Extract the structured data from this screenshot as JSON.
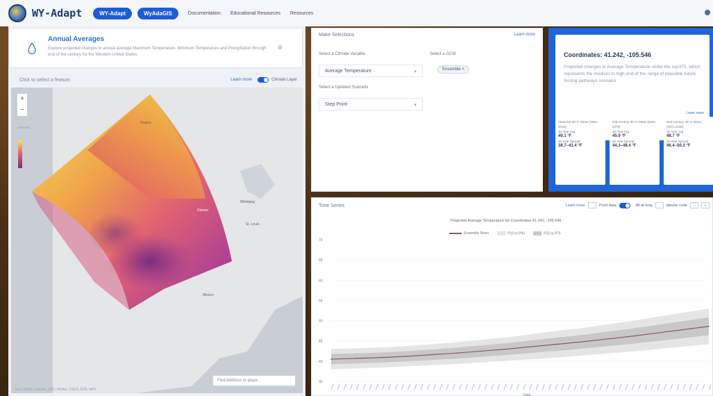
{
  "header": {
    "brand": "WY-Adapt",
    "pills": [
      "WY-Adapt",
      "WyAdaGIS"
    ],
    "nav": [
      "Documentation",
      "Educational Resources",
      "Resources"
    ]
  },
  "annual": {
    "title": "Annual Averages",
    "description": "Explore projected changes in annual average Maximum Temperature, Minimum Temperature and Precipitation through end of the century for the Western United States."
  },
  "map_bar": {
    "title": "Click to select a feature",
    "learn": "Learn more",
    "toggle_label": "Climate Layer"
  },
  "map": {
    "search_placeholder": "Find Address or place",
    "attribution": "Esri, HERE, Garmin, FAO, NOAA, USGS, EPA, NPS",
    "labels": [
      "Regina",
      "Winnipeg",
      "Denver",
      "St. Louis",
      "Mexico"
    ]
  },
  "variables": {
    "title": "Make Selections",
    "learn": "Learn more",
    "climate_label": "Select a Climate Variable",
    "climate_value": "Average Temperature",
    "gcm_label": "Select a GCM",
    "gcm_chip": "Ensemble",
    "scenario_label": "Select a Updated Scenario",
    "scenario_value": "Step Point"
  },
  "coords": {
    "title": "Coordinates: 41.242, -105.546",
    "description": "Projected changes in Average Temperature under the ssp370, which represents the medium to high end of the range of plausible future forcing pathways scenario.",
    "learn": "Learn more",
    "stats": [
      {
        "head": "Historical 30-Yr Mean (1981-2010)",
        "l1": "30-Year Avg",
        "v1": "40.1 °F",
        "l2": "30-Year Spread",
        "v2": "38.7–41.4 °F"
      },
      {
        "head": "Mid-Century 30-Yr Mean (2041-2070)",
        "l1": "30-Year Avg",
        "v1": "45.9 °F",
        "l2": "30-Year Spread",
        "v2": "44.3–48.4 °F"
      },
      {
        "head": "End-Century 30-Yr Mean (2071-2100)",
        "l1": "30-Year Avg",
        "v1": "48.7 °F",
        "l2": "30-Year Spread",
        "v2": "46.4–50.3 °F"
      }
    ]
  },
  "timeseries": {
    "title": "Time Series",
    "learn": "Learn more",
    "controls": [
      "Point data",
      "All at long",
      "tabular code"
    ],
    "chart_title": "Projected Average Temperature for Coordinates 41.242, -105.546",
    "legend": [
      "Ensemble Mean",
      "P10 to P90",
      "P25 to P75"
    ],
    "yticks": [
      "70",
      "65",
      "60",
      "55",
      "50",
      "45",
      "40",
      "35"
    ],
    "xlabel": "Date"
  },
  "chart_data": {
    "type": "line",
    "title": "Projected Average Temperature for Coordinates 41.242, -105.546",
    "xlabel": "Date",
    "ylabel": "",
    "x": [
      1950,
      1960,
      1970,
      1980,
      1990,
      2000,
      2010,
      2020,
      2030,
      2040,
      2050,
      2060,
      2070,
      2080,
      2090,
      2100
    ],
    "series": [
      {
        "name": "Ensemble Mean",
        "values": [
          40.5,
          40.7,
          40.9,
          41.2,
          41.6,
          42.0,
          42.5,
          43.0,
          43.6,
          44.2,
          44.8,
          45.5,
          46.2,
          47.0,
          47.8,
          48.6
        ]
      },
      {
        "name": "P10 to P90",
        "values": [
          38.0,
          38.2,
          38.4,
          38.7,
          39.0,
          39.3,
          39.7,
          40.1,
          40.5,
          40.9,
          41.4,
          41.9,
          42.4,
          43.0,
          43.6,
          44.2
        ],
        "upper": [
          43.0,
          43.2,
          43.4,
          43.7,
          44.2,
          44.7,
          45.3,
          45.9,
          46.7,
          47.5,
          48.2,
          49.1,
          50.0,
          51.0,
          52.0,
          53.0
        ]
      }
    ],
    "ylim": [
      35,
      70
    ]
  },
  "colors": {
    "accent": "#1e5bd8",
    "coord_bg": "#1e66d8",
    "mean_line": "#8a5a5a",
    "band_outer": "#e5e5e5",
    "band_inner": "#c8c8c8"
  }
}
